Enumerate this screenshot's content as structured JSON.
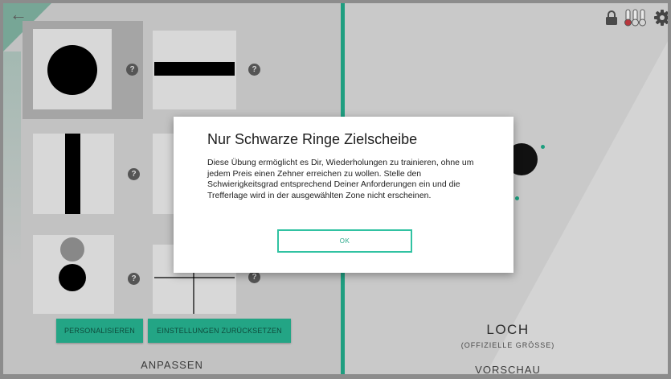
{
  "nav": {
    "back_icon": "arrow-left-icon"
  },
  "toolbar": {
    "icons": [
      "lock-icon",
      "thermometers-icon",
      "gear-icon"
    ]
  },
  "targets": {
    "help_label": "?",
    "tiles": [
      {
        "name": "black-disc-target",
        "selected": true
      },
      {
        "name": "horizontal-bar-target",
        "selected": false
      },
      {
        "name": "vertical-bar-target",
        "selected": false
      },
      {
        "name": "hidden-target-b",
        "selected": false
      },
      {
        "name": "two-discs-target",
        "selected": false
      },
      {
        "name": "crosshair-target",
        "selected": false
      }
    ]
  },
  "buttons": {
    "personalize": "PERSONALISIEREN",
    "reset": "EINSTELLUNGEN ZURÜCKSETZEN"
  },
  "left_panel": {
    "title": "ANPASSEN"
  },
  "preview": {
    "target_name": "LOCH",
    "subtitle": "(OFFIZIELLE GRÖSSE)",
    "title": "VORSCHAU"
  },
  "dialog": {
    "title": "Nur Schwarze Ringe Zielscheibe",
    "body": "Diese Übung ermöglicht es Dir, Wiederholungen zu trainieren, ohne um jedem Preis einen Zehner erreichen zu wollen. Stelle den Schwierigkeitsgrad entsprechend Deiner Anforderungen ein und die Trefferlage wird in der ausgewählten Zone nicht erscheinen.",
    "ok_label": "OK"
  },
  "colors": {
    "accent": "#1f9e80",
    "button_green": "#23a585",
    "dialog_border": "#31c2a2"
  }
}
